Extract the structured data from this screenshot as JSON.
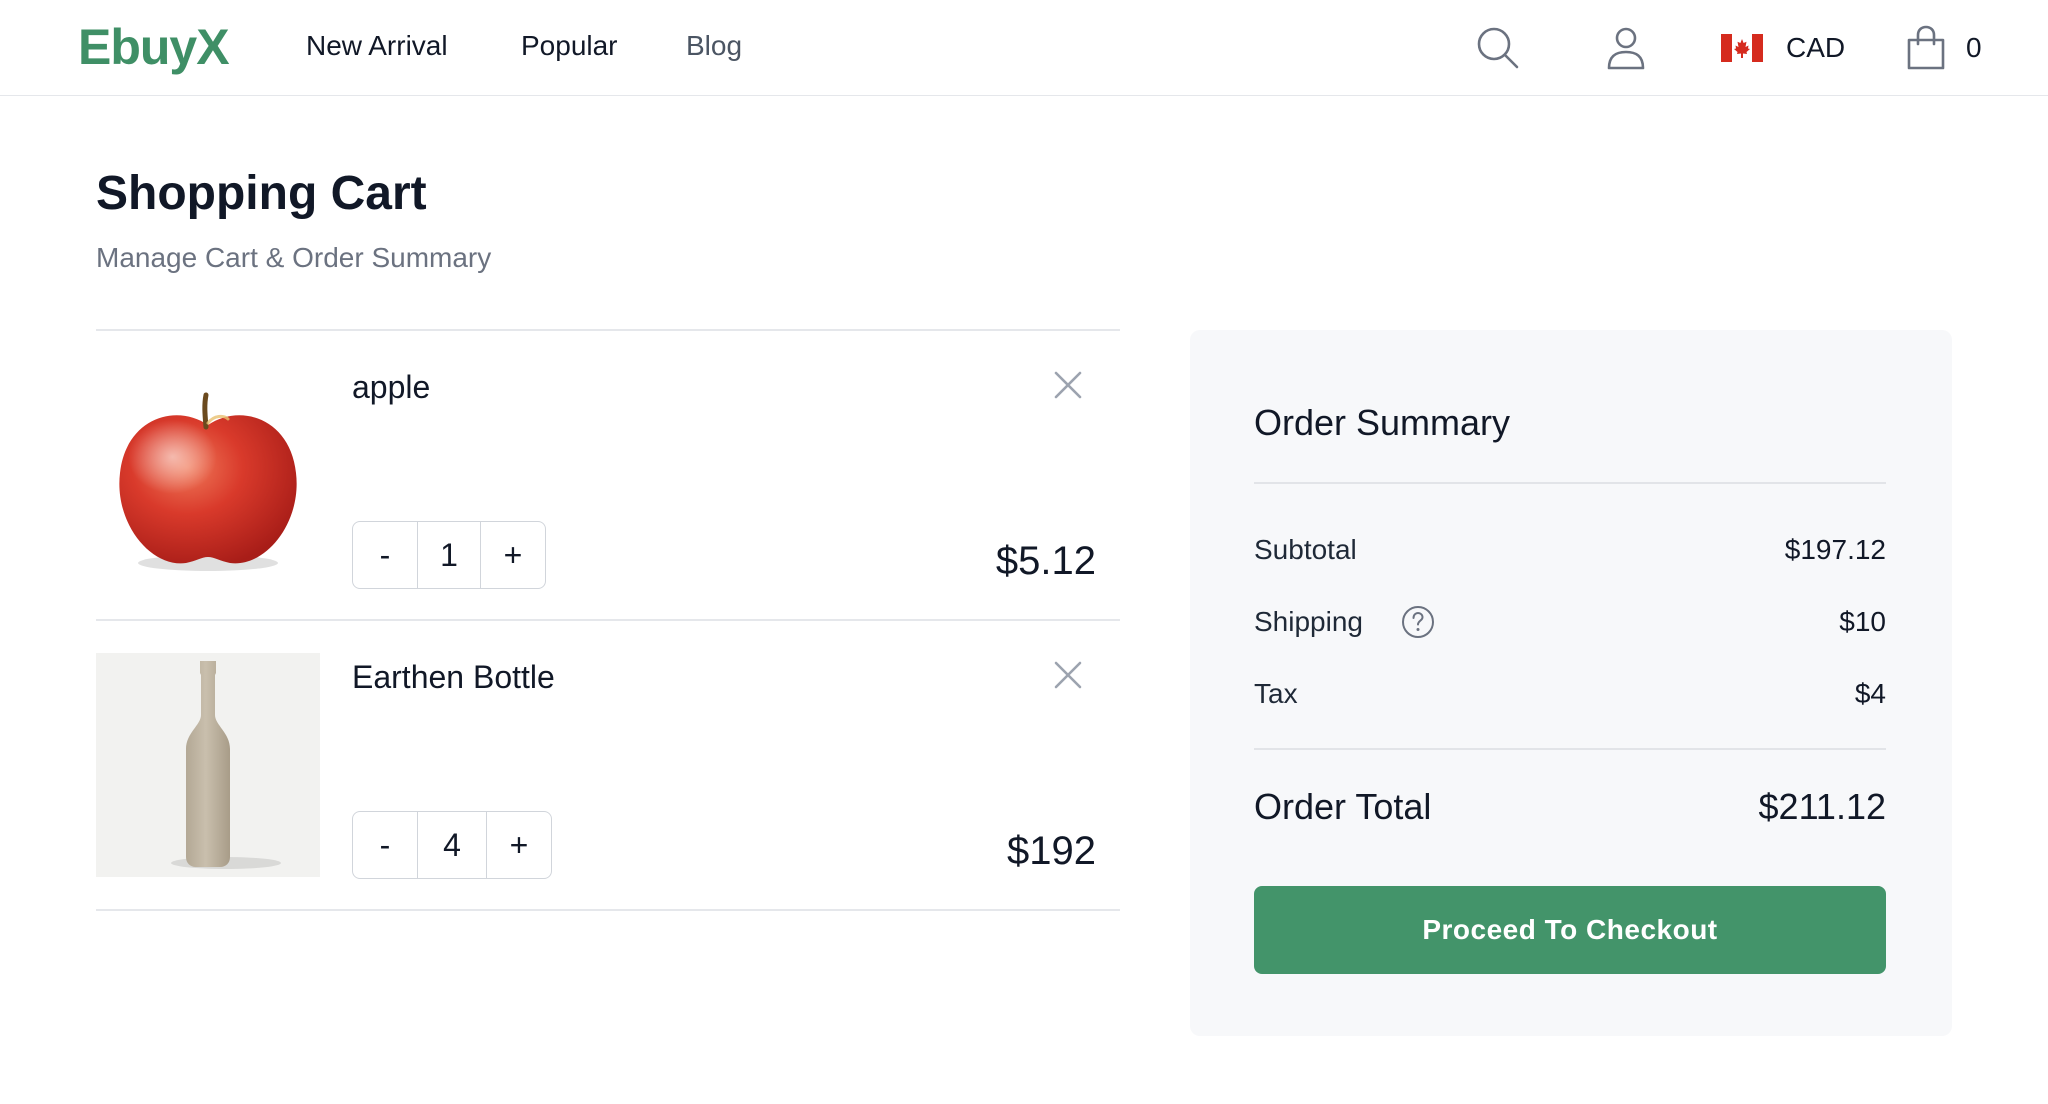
{
  "header": {
    "logo": "EbuyX",
    "nav": [
      "New Arrival",
      "Popular",
      "Blog"
    ],
    "currency": "CAD",
    "cart_count": "0",
    "icons": [
      "search-icon",
      "user-icon",
      "canada-flag-icon",
      "shopping-bag-icon"
    ],
    "brand_color": "#3f8f66"
  },
  "page": {
    "title": "Shopping Cart",
    "subtitle": "Manage Cart & Order Summary"
  },
  "cart": {
    "items": [
      {
        "name": "apple",
        "quantity": "1",
        "price": "$5.12",
        "decrement_label": "-",
        "increment_label": "+",
        "image": "apple-image"
      },
      {
        "name": "Earthen Bottle",
        "quantity": "4",
        "price": "$192",
        "decrement_label": "-",
        "increment_label": "+",
        "image": "earthen-bottle-image"
      }
    ]
  },
  "summary": {
    "title": "Order Summary",
    "subtotal_label": "Subtotal",
    "subtotal_value": "$197.12",
    "shipping_label": "Shipping",
    "shipping_value": "$10",
    "tax_label": "Tax",
    "tax_value": "$4",
    "total_label": "Order Total",
    "total_value": "$211.12",
    "checkout_label": "Proceed To Checkout",
    "button_color": "#43946a"
  }
}
